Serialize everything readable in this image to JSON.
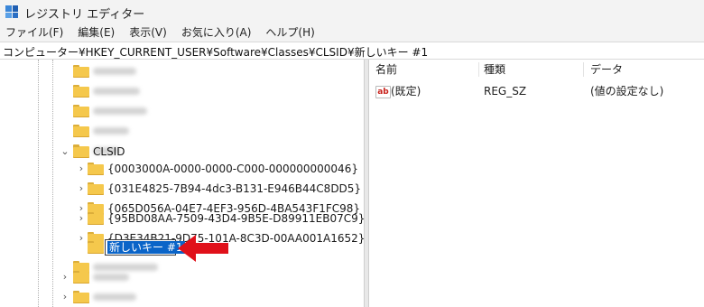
{
  "window": {
    "title": "レジストリ エディター",
    "icon": "registry-editor-icon"
  },
  "menu": [
    "ファイル(F)",
    "編集(E)",
    "表示(V)",
    "お気に入り(A)",
    "ヘルプ(H)"
  ],
  "address": "コンピューター¥HKEY_CURRENT_USER¥Software¥Classes¥CLSID¥新しいキー #1",
  "tree": {
    "clsid_label": "CLSID",
    "clsid_children": [
      "{0003000A-0000-0000-C000-000000000046}",
      "{031E4825-7B94-4dc3-B131-E946B44C8DD5}",
      "{065D056A-04E7-4EF3-956D-4BA543F1FC98}",
      "{95BD08AA-7509-43D4-9B5E-D89911EB07C9}",
      "{D3E34B21-9D75-101A-8C3D-00AA001A1652}"
    ],
    "new_key_label": "新しいキー #1"
  },
  "list": {
    "columns": [
      "名前",
      "種類",
      "データ"
    ],
    "rows": [
      {
        "name": "(既定)",
        "type": "REG_SZ",
        "data": "(値の設定なし)",
        "icon": "string-value-icon"
      }
    ]
  },
  "annotation": {
    "color": "#e0101a",
    "icon": "red-arrow-pointing-left"
  }
}
